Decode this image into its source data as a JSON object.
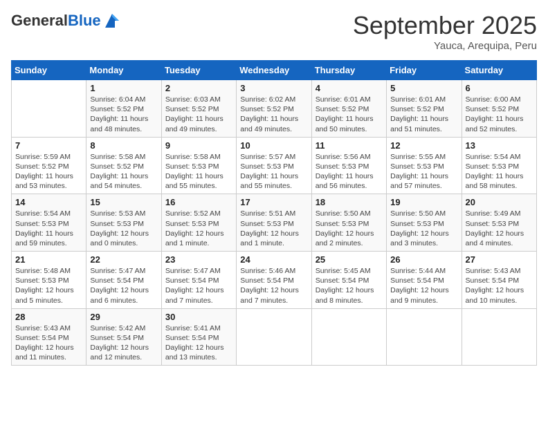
{
  "header": {
    "logo_general": "General",
    "logo_blue": "Blue",
    "month": "September 2025",
    "location": "Yauca, Arequipa, Peru"
  },
  "days_of_week": [
    "Sunday",
    "Monday",
    "Tuesday",
    "Wednesday",
    "Thursday",
    "Friday",
    "Saturday"
  ],
  "weeks": [
    [
      {
        "day": "",
        "info": ""
      },
      {
        "day": "1",
        "info": "Sunrise: 6:04 AM\nSunset: 5:52 PM\nDaylight: 11 hours and 48 minutes."
      },
      {
        "day": "2",
        "info": "Sunrise: 6:03 AM\nSunset: 5:52 PM\nDaylight: 11 hours and 49 minutes."
      },
      {
        "day": "3",
        "info": "Sunrise: 6:02 AM\nSunset: 5:52 PM\nDaylight: 11 hours and 49 minutes."
      },
      {
        "day": "4",
        "info": "Sunrise: 6:01 AM\nSunset: 5:52 PM\nDaylight: 11 hours and 50 minutes."
      },
      {
        "day": "5",
        "info": "Sunrise: 6:01 AM\nSunset: 5:52 PM\nDaylight: 11 hours and 51 minutes."
      },
      {
        "day": "6",
        "info": "Sunrise: 6:00 AM\nSunset: 5:52 PM\nDaylight: 11 hours and 52 minutes."
      }
    ],
    [
      {
        "day": "7",
        "info": "Sunrise: 5:59 AM\nSunset: 5:52 PM\nDaylight: 11 hours and 53 minutes."
      },
      {
        "day": "8",
        "info": "Sunrise: 5:58 AM\nSunset: 5:52 PM\nDaylight: 11 hours and 54 minutes."
      },
      {
        "day": "9",
        "info": "Sunrise: 5:58 AM\nSunset: 5:53 PM\nDaylight: 11 hours and 55 minutes."
      },
      {
        "day": "10",
        "info": "Sunrise: 5:57 AM\nSunset: 5:53 PM\nDaylight: 11 hours and 55 minutes."
      },
      {
        "day": "11",
        "info": "Sunrise: 5:56 AM\nSunset: 5:53 PM\nDaylight: 11 hours and 56 minutes."
      },
      {
        "day": "12",
        "info": "Sunrise: 5:55 AM\nSunset: 5:53 PM\nDaylight: 11 hours and 57 minutes."
      },
      {
        "day": "13",
        "info": "Sunrise: 5:54 AM\nSunset: 5:53 PM\nDaylight: 11 hours and 58 minutes."
      }
    ],
    [
      {
        "day": "14",
        "info": "Sunrise: 5:54 AM\nSunset: 5:53 PM\nDaylight: 11 hours and 59 minutes."
      },
      {
        "day": "15",
        "info": "Sunrise: 5:53 AM\nSunset: 5:53 PM\nDaylight: 12 hours and 0 minutes."
      },
      {
        "day": "16",
        "info": "Sunrise: 5:52 AM\nSunset: 5:53 PM\nDaylight: 12 hours and 1 minute."
      },
      {
        "day": "17",
        "info": "Sunrise: 5:51 AM\nSunset: 5:53 PM\nDaylight: 12 hours and 1 minute."
      },
      {
        "day": "18",
        "info": "Sunrise: 5:50 AM\nSunset: 5:53 PM\nDaylight: 12 hours and 2 minutes."
      },
      {
        "day": "19",
        "info": "Sunrise: 5:50 AM\nSunset: 5:53 PM\nDaylight: 12 hours and 3 minutes."
      },
      {
        "day": "20",
        "info": "Sunrise: 5:49 AM\nSunset: 5:53 PM\nDaylight: 12 hours and 4 minutes."
      }
    ],
    [
      {
        "day": "21",
        "info": "Sunrise: 5:48 AM\nSunset: 5:53 PM\nDaylight: 12 hours and 5 minutes."
      },
      {
        "day": "22",
        "info": "Sunrise: 5:47 AM\nSunset: 5:54 PM\nDaylight: 12 hours and 6 minutes."
      },
      {
        "day": "23",
        "info": "Sunrise: 5:47 AM\nSunset: 5:54 PM\nDaylight: 12 hours and 7 minutes."
      },
      {
        "day": "24",
        "info": "Sunrise: 5:46 AM\nSunset: 5:54 PM\nDaylight: 12 hours and 7 minutes."
      },
      {
        "day": "25",
        "info": "Sunrise: 5:45 AM\nSunset: 5:54 PM\nDaylight: 12 hours and 8 minutes."
      },
      {
        "day": "26",
        "info": "Sunrise: 5:44 AM\nSunset: 5:54 PM\nDaylight: 12 hours and 9 minutes."
      },
      {
        "day": "27",
        "info": "Sunrise: 5:43 AM\nSunset: 5:54 PM\nDaylight: 12 hours and 10 minutes."
      }
    ],
    [
      {
        "day": "28",
        "info": "Sunrise: 5:43 AM\nSunset: 5:54 PM\nDaylight: 12 hours and 11 minutes."
      },
      {
        "day": "29",
        "info": "Sunrise: 5:42 AM\nSunset: 5:54 PM\nDaylight: 12 hours and 12 minutes."
      },
      {
        "day": "30",
        "info": "Sunrise: 5:41 AM\nSunset: 5:54 PM\nDaylight: 12 hours and 13 minutes."
      },
      {
        "day": "",
        "info": ""
      },
      {
        "day": "",
        "info": ""
      },
      {
        "day": "",
        "info": ""
      },
      {
        "day": "",
        "info": ""
      }
    ]
  ]
}
